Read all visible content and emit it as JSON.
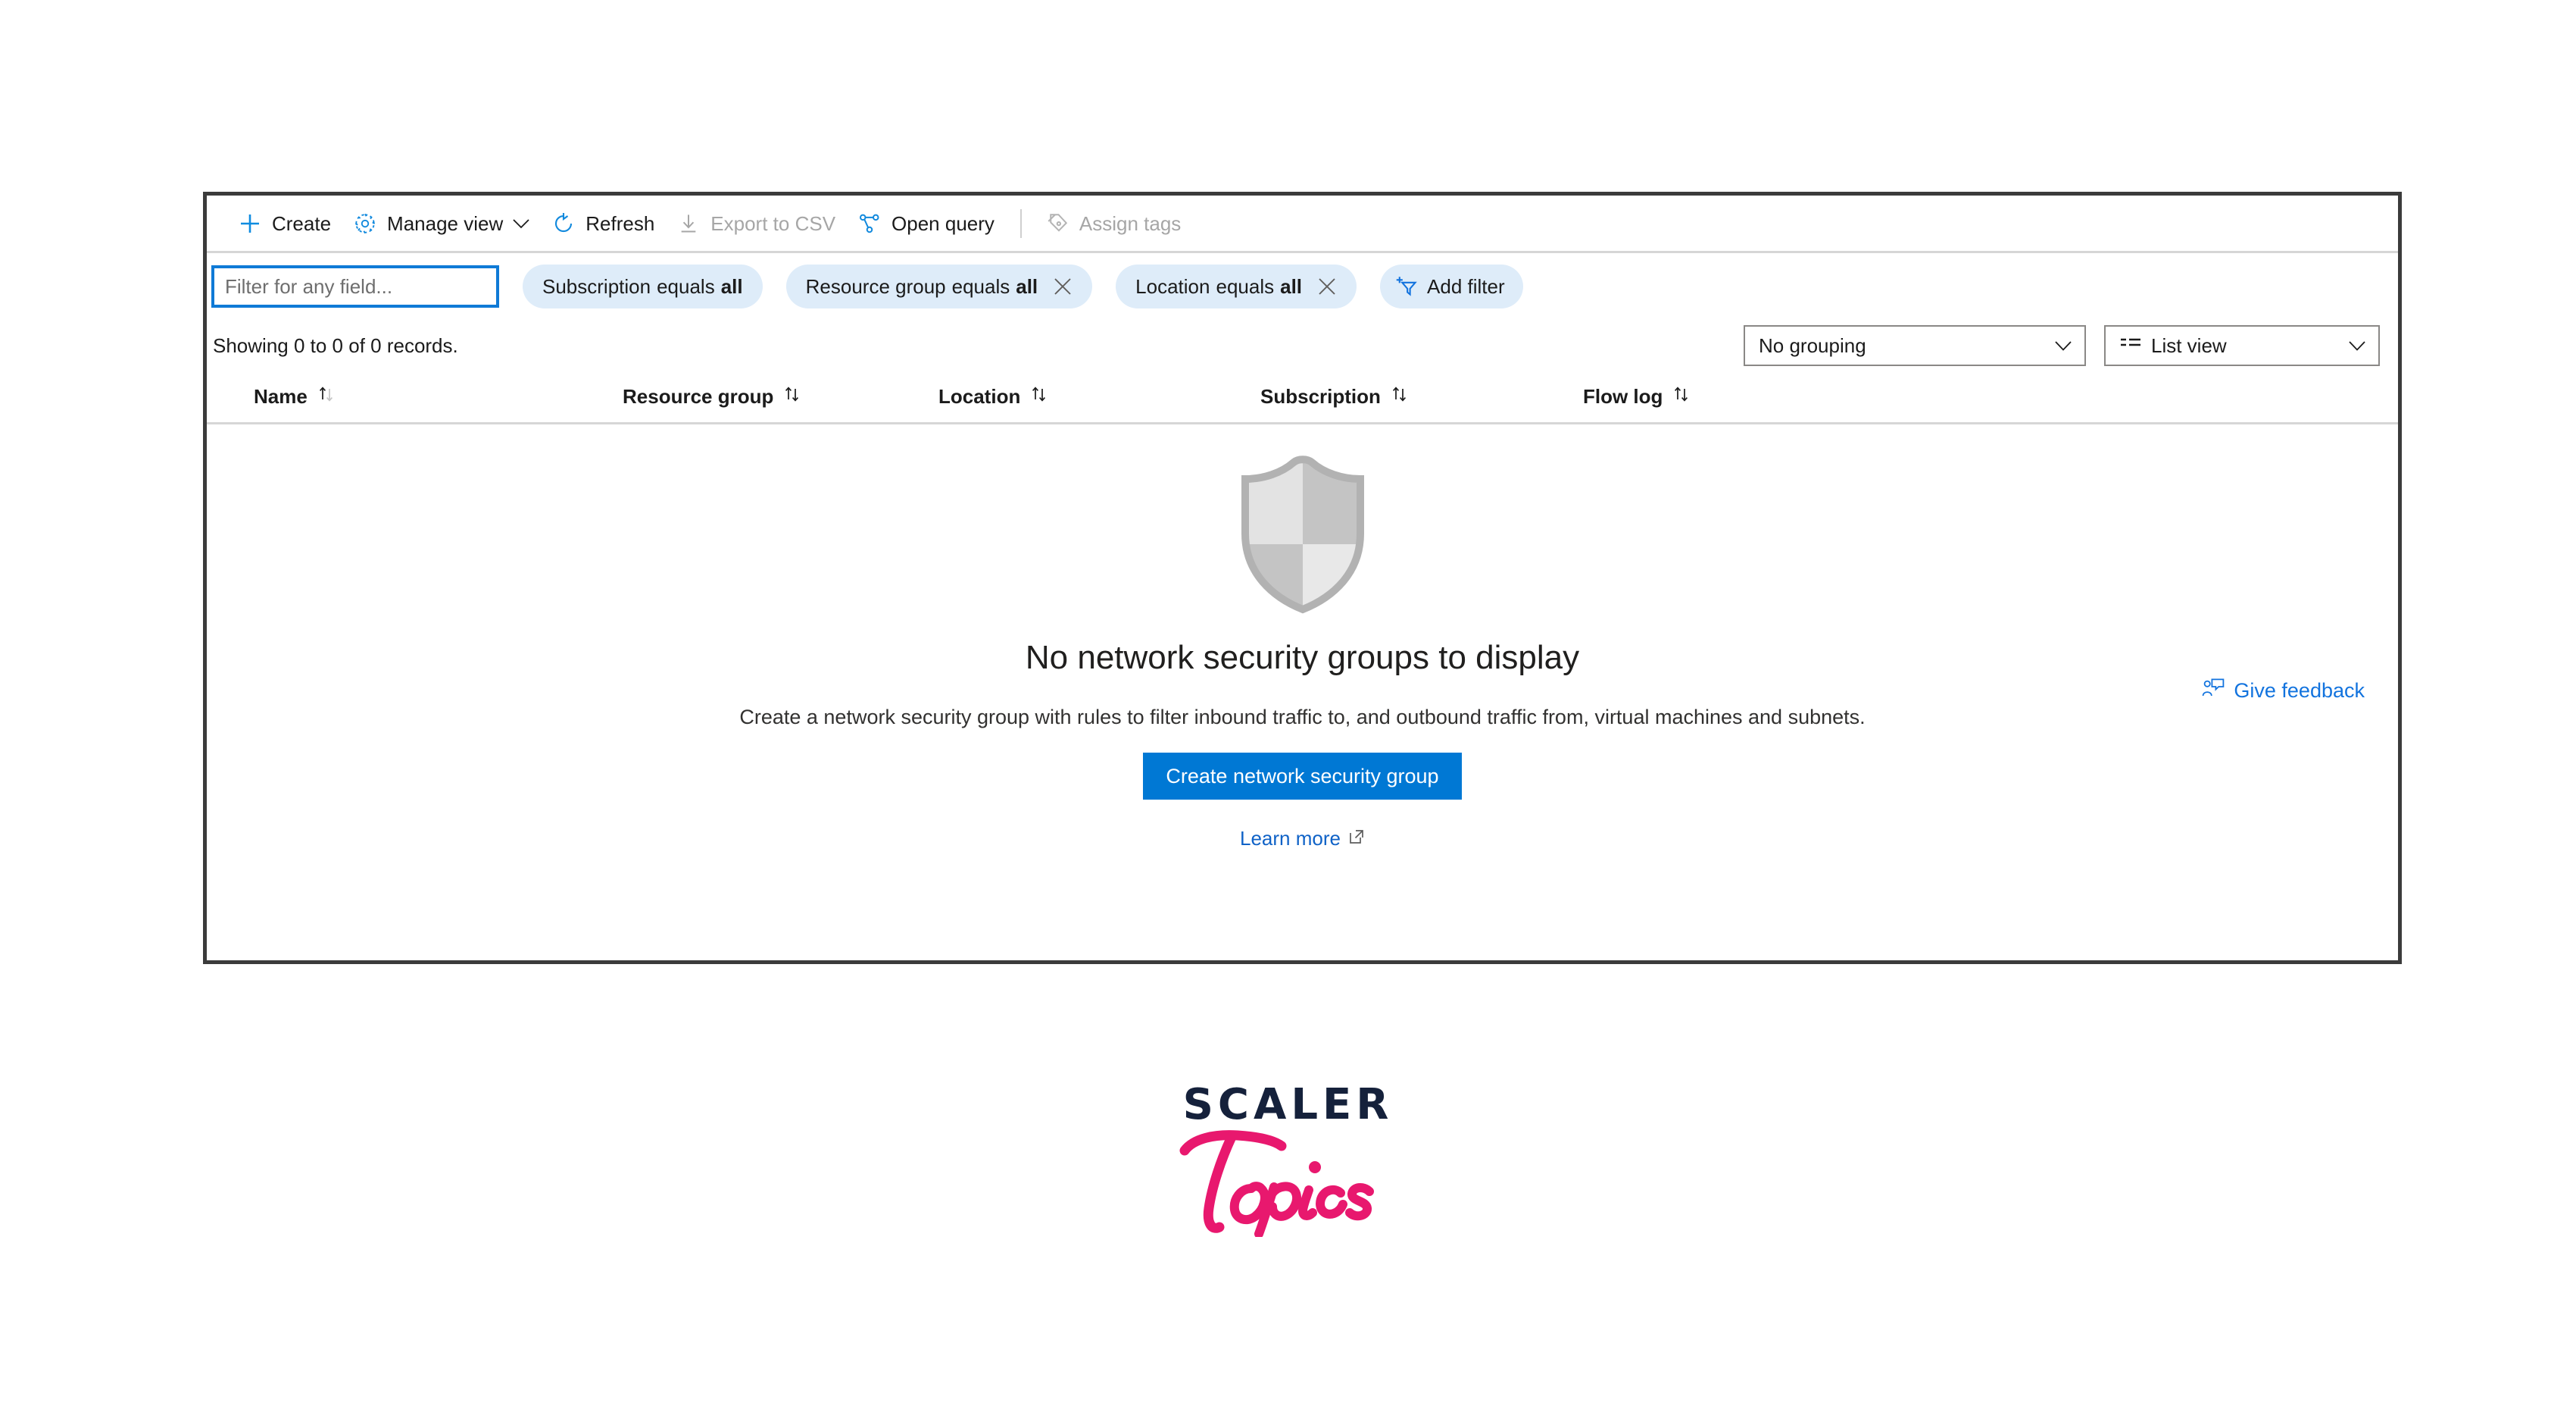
{
  "panel": {
    "command_bar": {
      "items": [
        {
          "label": "Create",
          "icon": "plus-icon",
          "disabled": false,
          "has_chevron": false
        },
        {
          "label": "Manage view",
          "icon": "gear-icon",
          "disabled": false,
          "has_chevron": true
        },
        {
          "label": "Refresh",
          "icon": "refresh-icon",
          "disabled": false,
          "has_chevron": false
        },
        {
          "label": "Export to CSV",
          "icon": "download-icon",
          "disabled": true,
          "has_chevron": false
        },
        {
          "label": "Open query",
          "icon": "query-graph-icon",
          "disabled": false,
          "has_chevron": false
        },
        {
          "label": "Assign tags",
          "icon": "tag-icon",
          "disabled": true,
          "has_chevron": false
        }
      ]
    },
    "filters": {
      "search_placeholder": "Filter for any field...",
      "search_value": "",
      "pills": [
        {
          "field": "Subscription",
          "operator": "equals",
          "value": "all",
          "removable": false
        },
        {
          "field": "Resource group",
          "operator": "equals",
          "value": "all",
          "removable": true
        },
        {
          "field": "Location",
          "operator": "equals",
          "value": "all",
          "removable": true
        }
      ],
      "add_filter_label": "Add filter"
    },
    "summary": {
      "records_text": "Showing 0 to 0 of 0 records.",
      "grouping_value": "No grouping",
      "view_value": "List view"
    },
    "table": {
      "columns": [
        {
          "label": "Name",
          "sortable": true
        },
        {
          "label": "Resource group",
          "sortable": true
        },
        {
          "label": "Location",
          "sortable": true
        },
        {
          "label": "Subscription",
          "sortable": true
        },
        {
          "label": "Flow log",
          "sortable": true
        }
      ]
    },
    "empty_state": {
      "title": "No network security groups to display",
      "description": "Create a network security group with rules to filter inbound traffic to, and outbound traffic from, virtual machines and subnets.",
      "primary_button": "Create network security group",
      "learn_more": "Learn more",
      "feedback": "Give feedback"
    }
  },
  "branding": {
    "wordmark_top": "SCALER",
    "wordmark_bottom": "Topics"
  },
  "colors": {
    "accent_blue": "#0078d4",
    "link_blue": "#0f62c7",
    "pill_bg": "#deecf9",
    "panel_border": "#3b3b3b",
    "brand_navy": "#15213b",
    "brand_pink": "#e8186e"
  }
}
